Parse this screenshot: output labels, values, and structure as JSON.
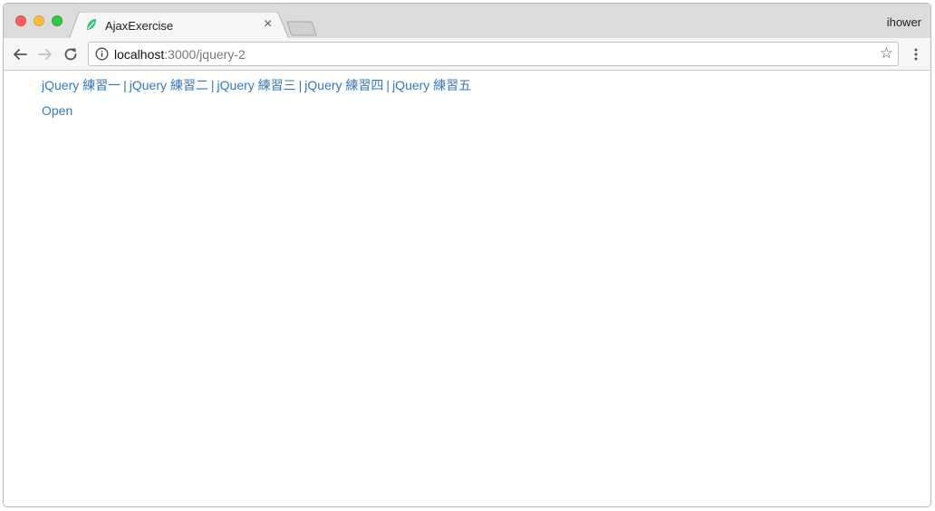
{
  "browser": {
    "tab_title": "AjaxExercise",
    "tab_close": "×",
    "profile_name": "ihower",
    "url_host": "localhost",
    "url_path": ":3000/jquery-2"
  },
  "page": {
    "nav_links": [
      {
        "label": "jQuery 練習一"
      },
      {
        "label": "jQuery 練習二"
      },
      {
        "label": "jQuery 練習三"
      },
      {
        "label": "jQuery 練習四"
      },
      {
        "label": "jQuery 練習五"
      }
    ],
    "separator": "|",
    "open_link": "Open"
  },
  "icons": {
    "back": "back-arrow-icon",
    "forward": "forward-arrow-icon",
    "reload": "reload-icon",
    "info": "info-icon",
    "bookmark": "star-icon",
    "menu": "kebab-menu-icon",
    "favicon": "leaf-icon"
  },
  "colors": {
    "link": "#337ab7",
    "favicon": "#2ec27e"
  }
}
